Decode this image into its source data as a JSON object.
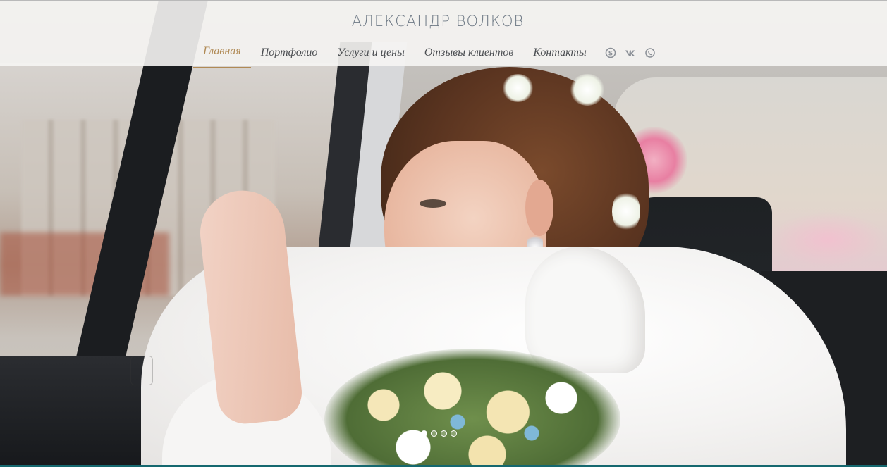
{
  "header": {
    "brand": "АЛЕКСАНДР ВОЛКОВ",
    "nav": [
      {
        "label": "Главная",
        "active": true
      },
      {
        "label": "Портфолио",
        "active": false
      },
      {
        "label": "Услуги и цены",
        "active": false
      },
      {
        "label": "Отзывы клиентов",
        "active": false
      },
      {
        "label": "Контакты",
        "active": false
      }
    ],
    "socials": [
      "skype-icon",
      "vk-icon",
      "whatsapp-icon"
    ]
  },
  "slider": {
    "dot_count": 4,
    "active_dot": 1
  },
  "colors": {
    "accent": "#b08a55",
    "nav_text": "#4b4e52",
    "brand_text": "#6f7a86",
    "bottom_bar": "#15686f"
  }
}
